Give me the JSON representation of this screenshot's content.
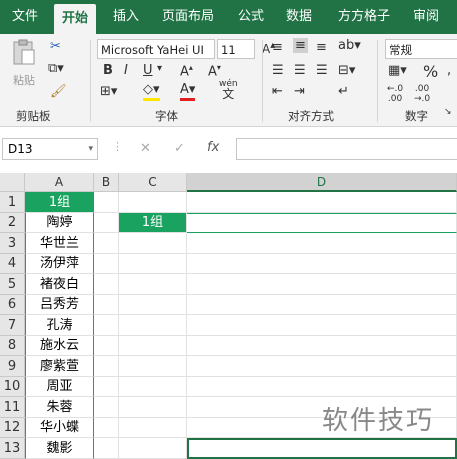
{
  "tabs": [
    "文件",
    "开始",
    "插入",
    "页面布局",
    "公式",
    "数据",
    "方方格子",
    "审阅"
  ],
  "active_tab": "开始",
  "ribbon": {
    "clipboard": {
      "paste": "粘贴",
      "label": "剪贴板"
    },
    "font": {
      "name": "Microsoft YaHei UI",
      "size": "11",
      "bold": "B",
      "italic": "I",
      "underline": "U",
      "label": "字体",
      "wen": "wén",
      "wen_char": "文"
    },
    "align": {
      "label": "对齐方式"
    },
    "number": {
      "format": "常规",
      "percent": "%",
      "label": "数字"
    }
  },
  "formula_bar": {
    "name_box": "D13",
    "cancel": "✕",
    "enter": "✓",
    "fx": "fx",
    "value": ""
  },
  "columns": [
    "A",
    "B",
    "C",
    "D"
  ],
  "rows": [
    "1",
    "2",
    "3",
    "4",
    "5",
    "6",
    "7",
    "8",
    "9",
    "10",
    "11",
    "12",
    "13"
  ],
  "column_a": [
    "1组",
    "陶婷",
    "华世兰",
    "汤伊萍",
    "褚夜白",
    "吕秀芳",
    "孔涛",
    "施水云",
    "廖紫萱",
    "周亚",
    "朱蓉",
    "华小蝶",
    "魏影"
  ],
  "c2": "1组",
  "watermark": "软件技巧",
  "colors": {
    "accent": "#217346",
    "green_cell": "#1aa260"
  }
}
